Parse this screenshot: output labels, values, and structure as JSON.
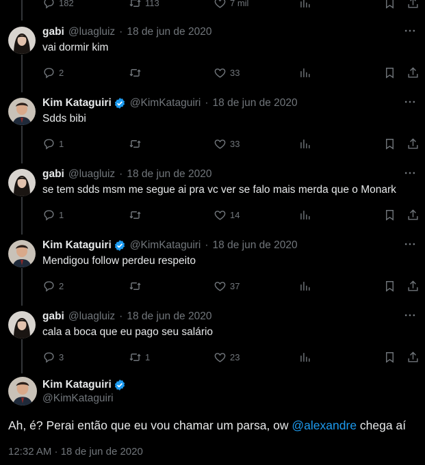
{
  "top_partial": {
    "reply_count": "182",
    "retweet_count": "113",
    "like_count": "7 mil"
  },
  "tweets": [
    {
      "name": "gabi",
      "handle": "@luagluiz",
      "sep": "·",
      "date": "18 de jun de 2020",
      "verified": false,
      "text": "vai dormir kim",
      "replies": "2",
      "retweets": "",
      "likes": "33"
    },
    {
      "name": "Kim Kataguiri",
      "handle": "@KimKataguiri",
      "sep": "·",
      "date": "18 de jun de 2020",
      "verified": true,
      "text": "Sdds bibi",
      "replies": "1",
      "retweets": "",
      "likes": "33"
    },
    {
      "name": "gabi",
      "handle": "@luagluiz",
      "sep": "·",
      "date": "18 de jun de 2020",
      "verified": false,
      "text": "se tem sdds msm me segue ai pra vc ver se falo mais merda que o Monark",
      "replies": "1",
      "retweets": "",
      "likes": "14"
    },
    {
      "name": "Kim Kataguiri",
      "handle": "@KimKataguiri",
      "sep": "·",
      "date": "18 de jun de 2020",
      "verified": true,
      "text": "Mendigou follow perdeu respeito",
      "replies": "2",
      "retweets": "",
      "likes": "37"
    },
    {
      "name": "gabi",
      "handle": "@luagluiz",
      "sep": "·",
      "date": "18 de jun de 2020",
      "verified": false,
      "text": "cala a boca que eu pago seu salário",
      "replies": "3",
      "retweets": "1",
      "likes": "23"
    }
  ],
  "main_tweet": {
    "name": "Kim Kataguiri",
    "handle": "@KimKataguiri",
    "text_before": "Ah, é? Perai então que eu vou chamar um parsa, ow ",
    "mention": "@alexandre",
    "text_after": " chega aí",
    "timestamp": "12:32 AM · 18 de jun de 2020"
  },
  "colors": {
    "background": "#000000",
    "text": "#e7e9ea",
    "muted": "#71767b",
    "accent": "#1d9bf0"
  }
}
